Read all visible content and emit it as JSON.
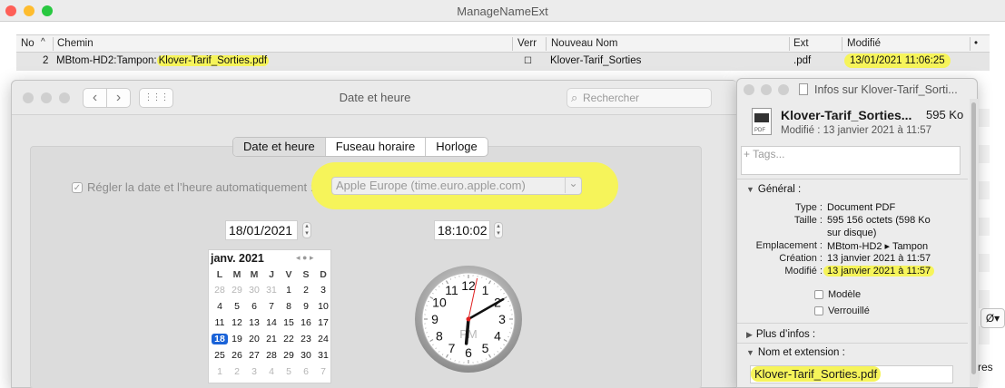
{
  "main_window": {
    "title": "ManageNameExt",
    "columns": [
      "No",
      "Chemin",
      "Verr",
      "Nouveau Nom",
      "Ext",
      "Modifié"
    ],
    "sort_indicator": "^",
    "options_dot": "•",
    "row": {
      "no": "2",
      "chemin_prefix": "MBtom-HD2:Tampon:",
      "chemin_file": "Klover-Tarif_Sorties.pdf",
      "verr": "☐",
      "nouveau_nom": "Klover-Tarif_Sorties",
      "ext": ".pdf",
      "modifie": "13/01/2021 11:06:25"
    },
    "right_peek_button": "Ø▾",
    "right_peek_text": "res"
  },
  "date_window": {
    "title": "Date et heure",
    "nav_back": "‹",
    "nav_forward": "›",
    "grid_icon": "⋮⋮⋮",
    "search_placeholder": "Rechercher",
    "search_icon": "⌕",
    "tabs": [
      "Date et heure",
      "Fuseau horaire",
      "Horloge"
    ],
    "auto_label": "Régler la date et l’heure automatiquement :",
    "auto_check": "✓",
    "server": "Apple Europe (time.euro.apple.com)",
    "server_chevron": "⌄",
    "date_value": "18/01/2021",
    "time_value": "18:10:02",
    "calendar": {
      "month_label": "janv. 2021",
      "nav": "◂ ● ▸",
      "weekdays": [
        "L",
        "M",
        "M",
        "J",
        "V",
        "S",
        "D"
      ],
      "weeks": [
        [
          "28",
          "29",
          "30",
          "31",
          "1",
          "2",
          "3"
        ],
        [
          "4",
          "5",
          "6",
          "7",
          "8",
          "9",
          "10"
        ],
        [
          "11",
          "12",
          "13",
          "14",
          "15",
          "16",
          "17"
        ],
        [
          "18",
          "19",
          "20",
          "21",
          "22",
          "23",
          "24"
        ],
        [
          "25",
          "26",
          "27",
          "28",
          "29",
          "30",
          "31"
        ],
        [
          "1",
          "2",
          "3",
          "4",
          "5",
          "6",
          "7"
        ]
      ],
      "selected": "18"
    },
    "clock": {
      "numbers": [
        "12",
        "1",
        "2",
        "3",
        "4",
        "5",
        "6",
        "7",
        "8",
        "9",
        "10",
        "11"
      ],
      "meridiem": "PM",
      "hour": 6,
      "minute": 10,
      "second": 2
    }
  },
  "info_window": {
    "title": "Infos sur Klover-Tarif_Sorti...",
    "doc_icon_label": "PDF",
    "file_name": "Klover-Tarif_Sorties...",
    "file_size": "595 Ko",
    "modified_line": "Modifié : 13 janvier 2021 à 11:57",
    "tags_placeholder": "+ Tags...",
    "general_label": "Général :",
    "general_rows": [
      {
        "label": "Type :",
        "value": "Document PDF"
      },
      {
        "label": "Taille :",
        "value": "595 156 octets (598 Ko"
      },
      {
        "label": "",
        "value": "sur disque)"
      },
      {
        "label": "Emplacement :",
        "value": "MBtom-HD2 ▸ Tampon"
      },
      {
        "label": "Création :",
        "value": "13 janvier 2021 à 11:57"
      },
      {
        "label": "Modifié :",
        "value": "13 janvier 2021 à 11:57"
      }
    ],
    "modele_label": "Modèle",
    "verrouille_label": "Verrouillé",
    "plus_infos_label": "Plus d’infos :",
    "nom_ext_label": "Nom et extension :",
    "name_field": "Klover-Tarif_Sorties.pdf",
    "tri_down": "▼",
    "tri_right": "▶"
  },
  "colors": {
    "highlight": "#f6f45a",
    "selected_day": "#1a63d8",
    "close": "#fe5f57",
    "minimize": "#febc2e",
    "zoom": "#28c840"
  }
}
